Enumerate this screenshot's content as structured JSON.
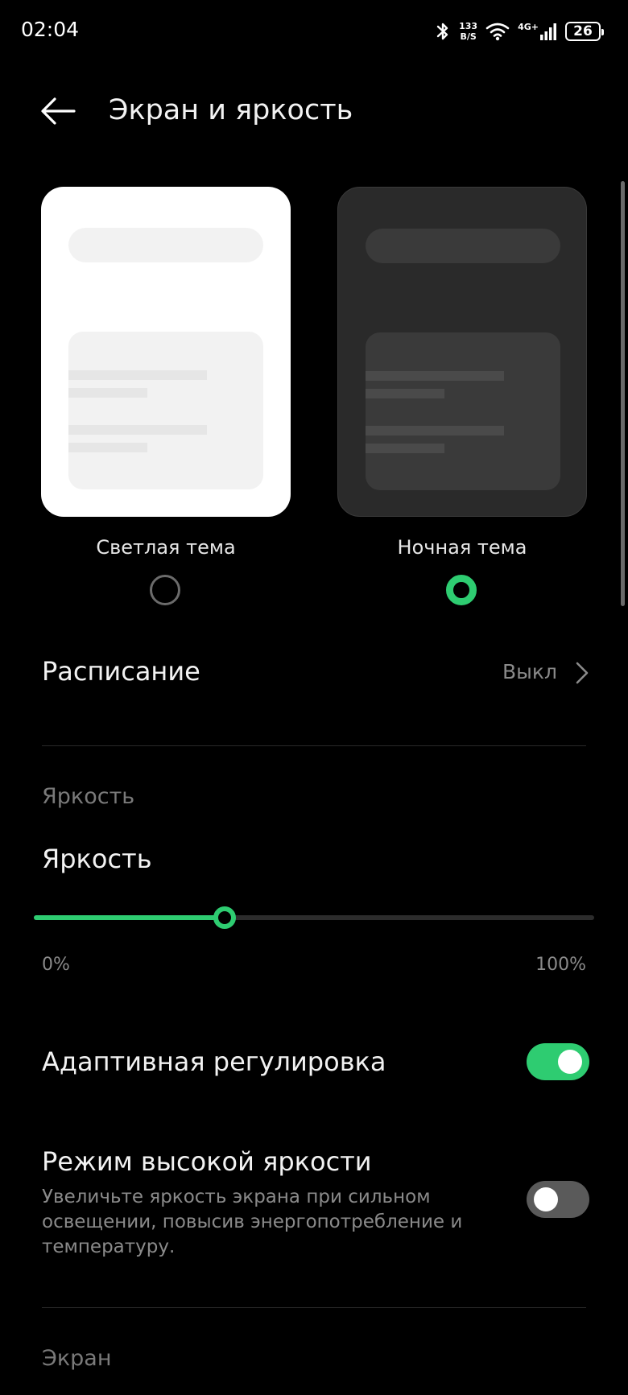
{
  "status_bar": {
    "time": "02:04",
    "net_speed_value": "133",
    "net_speed_unit": "B/S",
    "network": "4G+",
    "battery": "26",
    "icons": [
      "bluetooth-icon",
      "wifi-icon",
      "signal-icon",
      "battery-icon"
    ]
  },
  "header": {
    "title": "Экран и яркость"
  },
  "theme": {
    "light_label": "Светлая тема",
    "dark_label": "Ночная тема",
    "selected": "dark"
  },
  "schedule": {
    "label": "Расписание",
    "value": "Выкл"
  },
  "brightness_section": {
    "header": "Яркость",
    "label": "Яркость",
    "min_label": "0%",
    "max_label": "100%",
    "level_fraction": 0.34
  },
  "adaptive": {
    "label": "Адаптивная регулировка",
    "enabled": true
  },
  "high_brightness": {
    "label": "Режим высокой яркости",
    "description": "Увеличьте яркость экрана при сильном освещении, повысив энергопотребление и температуру.",
    "enabled": false
  },
  "screen_section": {
    "header": "Экран"
  },
  "colors": {
    "accent": "#2ecc71",
    "background": "#000000"
  }
}
